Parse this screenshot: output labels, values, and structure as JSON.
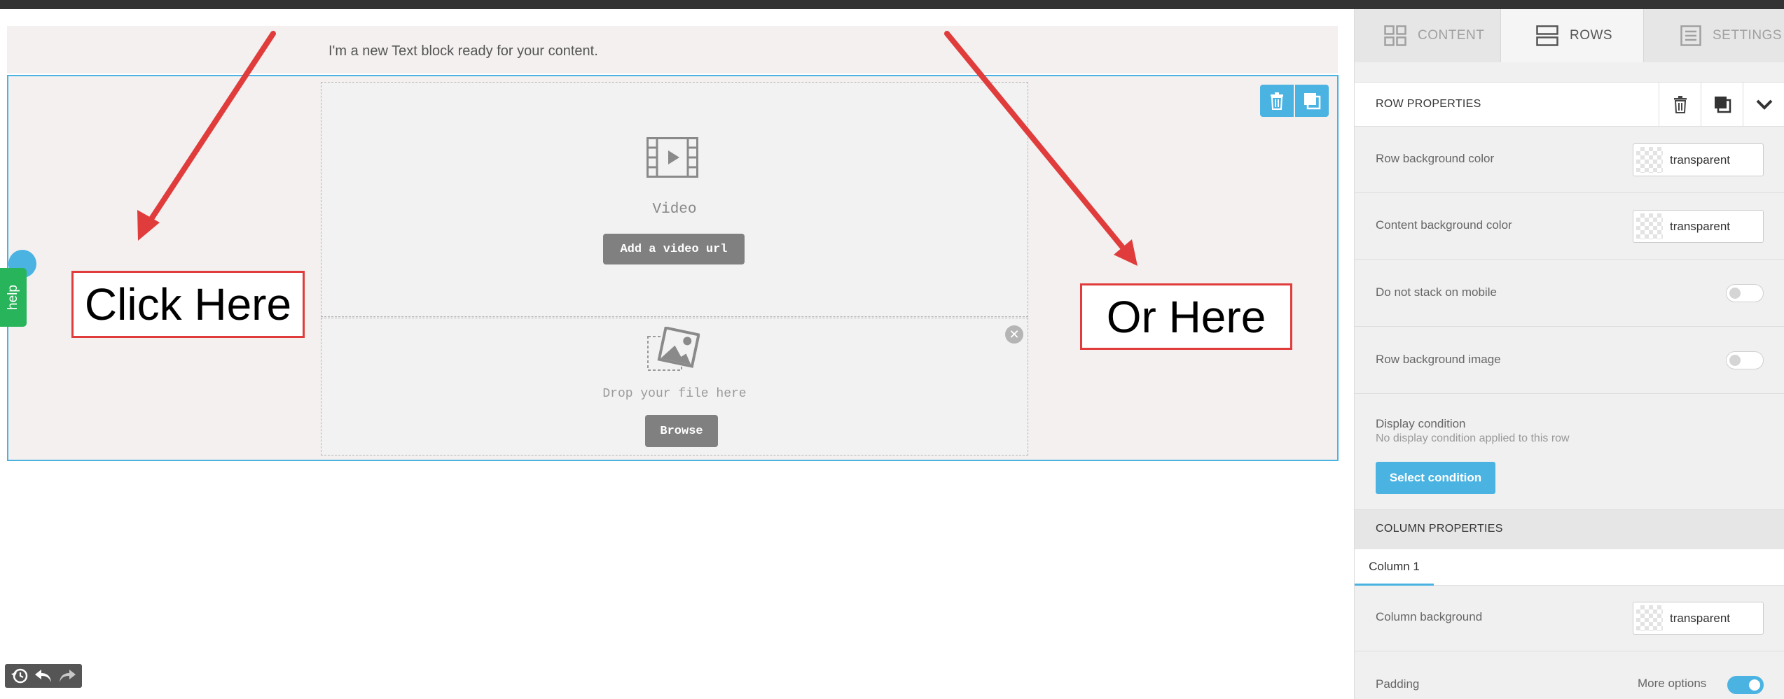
{
  "canvas": {
    "text_block": "I'm a new Text block ready for your content.",
    "video": {
      "label": "Video",
      "button": "Add a video url"
    },
    "image": {
      "drop_text": "Drop your file here",
      "button": "Browse"
    },
    "help_label": "help"
  },
  "annotations": {
    "left": "Click Here",
    "right": "Or Here",
    "color": "#e03c3c"
  },
  "panel": {
    "tabs": [
      {
        "label": "CONTENT",
        "icon": "grid-icon",
        "active": false
      },
      {
        "label": "ROWS",
        "icon": "rows-icon",
        "active": true
      },
      {
        "label": "SETTINGS",
        "icon": "settings-list-icon",
        "active": false
      }
    ],
    "row_properties": {
      "title": "ROW PROPERTIES",
      "row_bg_label": "Row background color",
      "row_bg_value": "transparent",
      "content_bg_label": "Content background color",
      "content_bg_value": "transparent",
      "stack_label": "Do not stack on mobile",
      "stack_on": false,
      "bg_image_label": "Row background image",
      "bg_image_on": false,
      "display_condition_label": "Display condition",
      "display_condition_sub": "No display condition applied to this row",
      "select_condition_button": "Select condition"
    },
    "column_properties": {
      "title": "COLUMN PROPERTIES",
      "tabs": [
        "Column 1"
      ],
      "column_bg_label": "Column background",
      "column_bg_value": "transparent",
      "padding_label": "Padding",
      "more_options_label": "More options",
      "more_options_on": true
    }
  },
  "colors": {
    "accent": "#4ab3e2",
    "help": "#28b45a",
    "topbar": "#333333"
  }
}
